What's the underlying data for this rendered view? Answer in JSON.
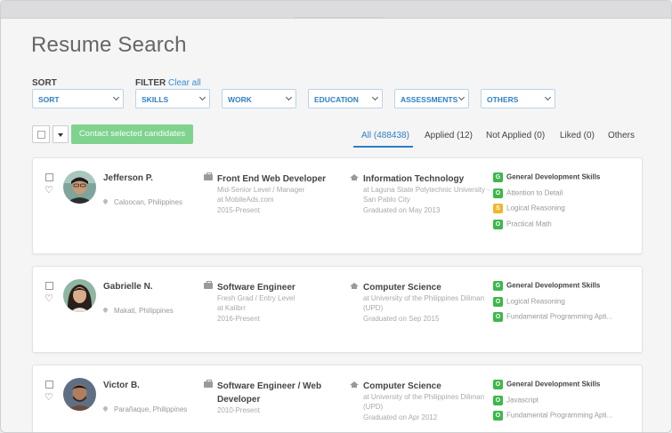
{
  "page_title": "Resume Search",
  "sort": {
    "label": "SORT",
    "dropdown": "SORT"
  },
  "filter": {
    "label": "FILTER",
    "clear_all": "Clear all",
    "dropdowns": [
      "SKILLS",
      "WORK",
      "EDUCATION",
      "ASSESSMENTS",
      "OTHERS"
    ]
  },
  "toolbar": {
    "contact_button": "Contact selected candidates"
  },
  "tabs": [
    {
      "label": "All (488438)",
      "active": true
    },
    {
      "label": "Applied (12)"
    },
    {
      "label": "Not Applied (0)"
    },
    {
      "label": "Liked (0)"
    },
    {
      "label": "Others"
    }
  ],
  "colors": {
    "accent": "#2f7fc4",
    "contact_button": "#7fd38f",
    "badge_green": "#3cb84a",
    "badge_yellow": "#f0b62a"
  },
  "candidates": [
    {
      "name": "Jefferson P.",
      "location": "Caloocan, Philippines",
      "job": {
        "title": "Front End Web Developer",
        "details": [
          "Mid-Senior Level / Manager",
          "at MobileAds.com",
          "2015-Present"
        ]
      },
      "education": {
        "title": "Information Technology",
        "details": [
          "at Laguna State Polytechnic University -",
          "San Pablo City",
          "Graduated on May 2013"
        ]
      },
      "skills": [
        {
          "badge": "G",
          "label": "General Development Skills",
          "bold": true
        },
        {
          "badge": "O",
          "label": "Attention to Detail"
        },
        {
          "badge": "S",
          "label": "Logical Reasoning"
        },
        {
          "badge": "O",
          "label": "Practical Math"
        }
      ]
    },
    {
      "name": "Gabrielle N.",
      "location": "Makati, Philippines",
      "job": {
        "title": "Software Engineer",
        "details": [
          "Fresh Grad / Entry Level",
          "at Kalibrr",
          "2016-Present"
        ]
      },
      "education": {
        "title": "Computer Science",
        "details": [
          "at University of the Philippines Diliman",
          "(UPD)",
          "Graduated on Sep 2015"
        ]
      },
      "skills": [
        {
          "badge": "G",
          "label": "General Development Skills",
          "bold": true
        },
        {
          "badge": "O",
          "label": "Logical Reasoning"
        },
        {
          "badge": "O",
          "label": "Fundamental Programming Apti..."
        }
      ]
    },
    {
      "name": "Victor B.",
      "location": "Parañaque, Philippines",
      "job": {
        "title": "Software Engineer / Web Developer",
        "details": [
          "2010-Present"
        ]
      },
      "education": {
        "title": "Computer Science",
        "details": [
          "at University of the Philippines Diliman",
          "(UPD)",
          "Graduated on Apr 2012"
        ]
      },
      "skills": [
        {
          "badge": "O",
          "label": "General Development Skills",
          "bold": true
        },
        {
          "badge": "O",
          "label": "Javascript"
        },
        {
          "badge": "O",
          "label": "Fundamental Programming Apti..."
        }
      ]
    }
  ]
}
